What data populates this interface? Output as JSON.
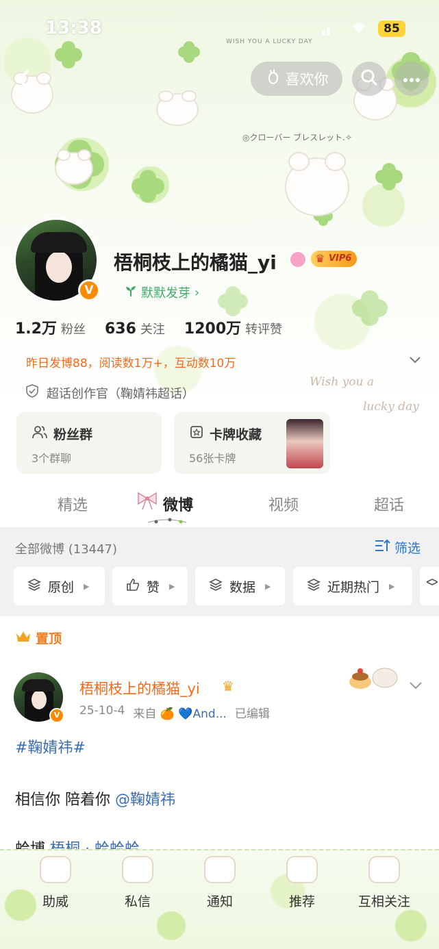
{
  "status_bar": {
    "time": "13:38",
    "battery": "85"
  },
  "header": {
    "like_button": "喜欢你"
  },
  "profile": {
    "name": "梧桐枝上的橘猫_yi",
    "vip_label": "VIP6",
    "verified_mark": "V",
    "sprout_text": "默默发芽",
    "stats": [
      {
        "value": "1.2万",
        "label": "粉丝"
      },
      {
        "value": "636",
        "label": "关注"
      },
      {
        "value": "1200万",
        "label": "转评赞"
      }
    ],
    "achievement": "昨日发博88，阅读数1万+，互动数10万",
    "creator_title": "超话创作官（鞠婧祎超话）",
    "banner_text_top": "WISH YOU A LUCKY DAY",
    "banner_text_mid": "◎クローバー ブレスレット.✧",
    "deco_text_line1": "Wish you a",
    "deco_text_line2": "lucky day"
  },
  "cards": [
    {
      "title": "粉丝群",
      "subtitle": "3个群聊"
    },
    {
      "title": "卡牌收藏",
      "subtitle": "56张卡牌"
    }
  ],
  "tabs": [
    "精选",
    "微博",
    "视频",
    "超话"
  ],
  "active_tab": "微博",
  "filter": {
    "all_label": "全部微博 (13447)",
    "filter_link": "筛选",
    "chips": [
      "原创",
      "赞",
      "数据",
      "近期热门"
    ]
  },
  "post": {
    "pinned_label": "置顶",
    "author": "梧桐枝上的橘猫_yi",
    "date": "25-10-4",
    "source_prefix": "来自",
    "source": "🍊 💙And...",
    "edited": "已编辑",
    "hashtag": "#鞠婧祎#",
    "text": "相信你 陪着你 ",
    "mention": "@鞠婧祎",
    "more_prefix": "蛤博",
    "more_mention": "梧桐 · 蛤蛤蛤"
  },
  "bottom_nav": [
    "助威",
    "私信",
    "通知",
    "推荐",
    "互相关注"
  ],
  "colors": {
    "accent_orange": "#f26b1d",
    "link_blue": "#2b75d6",
    "clover_green": "#a9d97e"
  }
}
